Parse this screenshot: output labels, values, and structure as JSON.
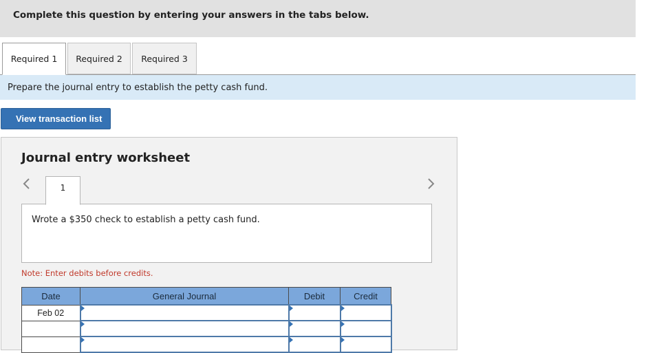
{
  "banner": {
    "text": "Complete this question by entering your answers in the tabs below."
  },
  "tabs": [
    {
      "label": "Required 1",
      "active": true
    },
    {
      "label": "Required 2",
      "active": false
    },
    {
      "label": "Required 3",
      "active": false
    }
  ],
  "instruction": "Prepare the journal entry to establish the petty cash fund.",
  "view_button": "View transaction list",
  "worksheet": {
    "title": "Journal entry worksheet",
    "prev_icon": "chevron-left-icon",
    "next_icon": "chevron-right-icon",
    "entry_tab": "1",
    "description": "Wrote a $350 check to establish a petty cash fund.",
    "note": "Note: Enter debits before credits.",
    "table": {
      "headers": [
        "Date",
        "General Journal",
        "Debit",
        "Credit"
      ],
      "rows": [
        {
          "date": "Feb 02",
          "account": "",
          "debit": "",
          "credit": ""
        },
        {
          "date": "",
          "account": "",
          "debit": "",
          "credit": ""
        },
        {
          "date": "",
          "account": "",
          "debit": "",
          "credit": ""
        }
      ]
    }
  },
  "colors": {
    "accent": "#3572b4",
    "header_bg": "#7ba7db",
    "instruction_bg": "#d9eaf7",
    "note": "#c0392b"
  }
}
